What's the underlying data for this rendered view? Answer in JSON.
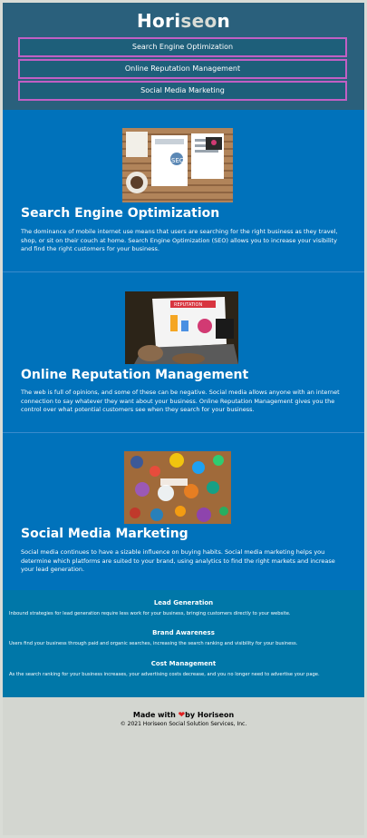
{
  "header": {
    "logo_part1": "Hori",
    "logo_part2": "seo",
    "logo_part3": "n",
    "nav": [
      {
        "label": "Search Engine Optimization"
      },
      {
        "label": "Online Reputation Management"
      },
      {
        "label": "Social Media Marketing"
      }
    ]
  },
  "sections": [
    {
      "title": "Search Engine Optimization",
      "text": "The dominance of mobile internet use means that users are searching for the right business as they travel, shop, or sit on their couch at home. Search Engine Optimization (SEO) allows you to increase your visibility and find the right customers for your business."
    },
    {
      "title": "Online Reputation Management",
      "text": "The web is full of opinions, and some of these can be negative. Social media allows anyone with an internet connection to say whatever they want about your business. Online Reputation Management gives you the control over what potential customers see when they search for your business."
    },
    {
      "title": "Social Media Marketing",
      "text": "Social media continues to have a sizable influence on buying habits. Social media marketing helps you determine which platforms are suited to your brand, using analytics to find the right markets and increase your lead generation."
    }
  ],
  "benefits": [
    {
      "title": "Lead Generation",
      "text": "Inbound strategies for lead generation require less work for your business, bringing customers directly to your website."
    },
    {
      "title": "Brand Awareness",
      "text": "Users find your business through paid and organic searches, increasing the search ranking and visibility for your business."
    },
    {
      "title": "Cost Management",
      "text": "As the search ranking for your business increases, your advertising costs decrease, and you no longer need to advertise your page."
    }
  ],
  "footer": {
    "made_with": "Made with",
    "by": "by Horiseon",
    "copyright": "© 2021 Horiseon Social Solution Services, Inc."
  },
  "images": {
    "seo_badge": "SEO",
    "reputation_badge": "REPUTATION"
  },
  "colors": {
    "header_bg": "#2a607c",
    "content_bg": "#0072bb",
    "benefits_bg": "#0077a8",
    "footer_bg": "#d3d6d0",
    "nav_border": "#c25fc4"
  }
}
